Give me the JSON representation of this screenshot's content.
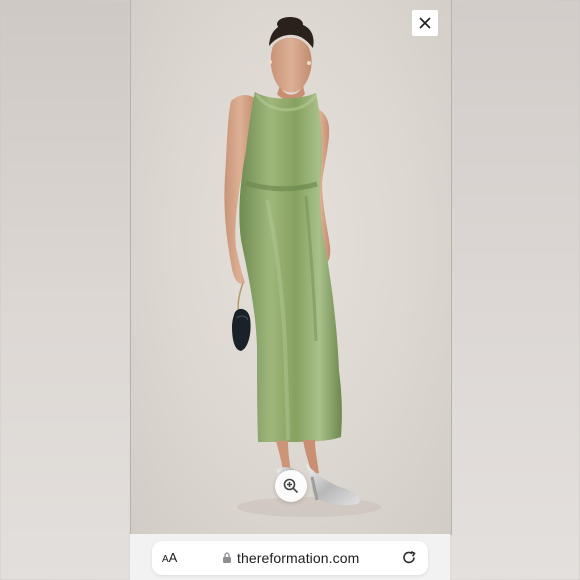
{
  "overlay": {
    "close_icon": "close-icon",
    "zoom_icon": "zoom-in-icon"
  },
  "photo": {
    "background_color": "#ddd7d1",
    "dress_color": "#8faa68",
    "shoe_color": "#c9c9c9",
    "bag_color": "#18212a"
  },
  "browser_bar": {
    "text_size_label_small": "A",
    "text_size_label_large": "A",
    "lock_icon": "lock-icon",
    "url": "thereformation.com",
    "reload_icon": "reload-icon"
  }
}
